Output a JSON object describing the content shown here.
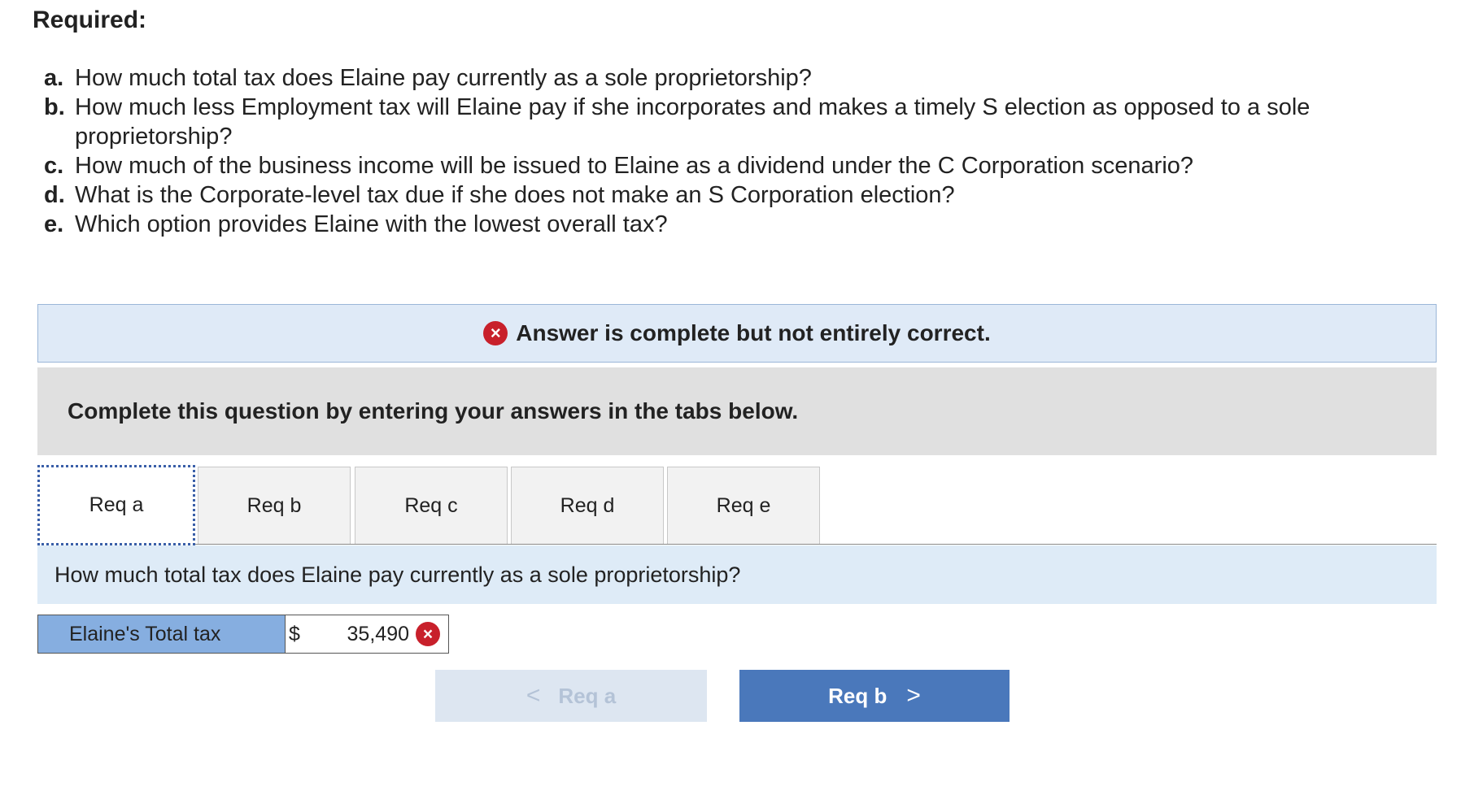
{
  "heading": "Required:",
  "requirements": [
    {
      "letter": "a.",
      "text": "How much total tax does Elaine pay currently as a sole proprietorship?"
    },
    {
      "letter": "b.",
      "text": "How much less Employment tax will Elaine pay if she incorporates and makes a timely S election as opposed to a sole proprietorship?"
    },
    {
      "letter": "c.",
      "text": "How much of the business income will be issued to Elaine as a dividend under the C Corporation scenario?"
    },
    {
      "letter": "d.",
      "text": "What is the Corporate-level tax due if she does not make an S Corporation election?"
    },
    {
      "letter": "e.",
      "text": "Which option provides Elaine with the lowest overall tax?"
    }
  ],
  "feedback": {
    "icon": "x-circle-icon",
    "icon_glyph": "×",
    "message": "Answer is complete but not entirely correct.",
    "color": "#c8202b"
  },
  "instructions": "Complete this question by entering your answers in the tabs below.",
  "tabs": [
    {
      "label": "Req a",
      "active": true
    },
    {
      "label": "Req b",
      "active": false
    },
    {
      "label": "Req c",
      "active": false
    },
    {
      "label": "Req d",
      "active": false
    },
    {
      "label": "Req e",
      "active": false
    }
  ],
  "question": "How much total tax does Elaine pay currently as a sole proprietorship?",
  "answer": {
    "label": "Elaine's Total tax",
    "currency": "$",
    "value": "35,490",
    "status": "incorrect",
    "status_glyph": "×"
  },
  "navigation": {
    "prev_label": "Req a",
    "prev_glyph": "<",
    "prev_enabled": false,
    "next_label": "Req b",
    "next_glyph": ">",
    "accent_color": "#4a78bb"
  }
}
